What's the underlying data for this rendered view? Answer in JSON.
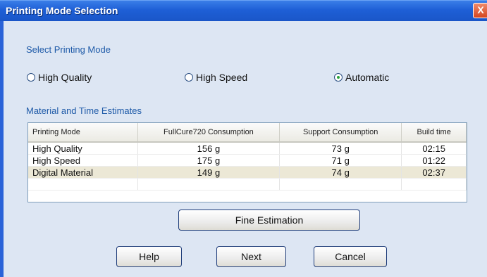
{
  "window": {
    "title": "Printing Mode Selection",
    "close_label": "X"
  },
  "mode_section": {
    "title": "Select Printing Mode",
    "options": [
      {
        "label": "High Quality",
        "selected": false
      },
      {
        "label": "High Speed",
        "selected": false
      },
      {
        "label": "Automatic",
        "selected": true
      }
    ]
  },
  "estimates_section": {
    "title": "Material and Time Estimates",
    "columns": [
      "Printing Mode",
      "FullCure720 Consumption",
      "Support Consumption",
      "Build time"
    ],
    "rows": [
      [
        "High Quality",
        "156 g",
        "73 g",
        "02:15"
      ],
      [
        "High Speed",
        "175 g",
        "71 g",
        "01:22"
      ],
      [
        "Digital Material",
        "149 g",
        "74 g",
        "02:37"
      ]
    ],
    "highlighted_row": 2
  },
  "buttons": {
    "fine_estimation": "Fine Estimation",
    "help": "Help",
    "next": "Next",
    "cancel": "Cancel"
  },
  "colors": {
    "titlebar": "#1e5fd6",
    "background": "#dde6f3",
    "section_title": "#1e5aa8",
    "selected_radio_dot": "#2aa33a",
    "highlight_row": "#ece8d6"
  }
}
